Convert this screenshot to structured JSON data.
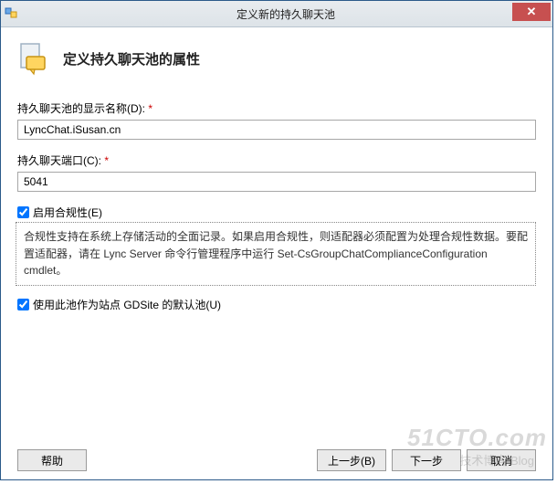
{
  "titlebar": {
    "title": "定义新的持久聊天池"
  },
  "header": {
    "heading": "定义持久聊天池的属性"
  },
  "fields": {
    "display_name_label": "持久聊天池的显示名称(D):",
    "display_name_value": "LyncChat.iSusan.cn",
    "port_label": "持久聊天端口(C):",
    "port_value": "5041"
  },
  "compliance": {
    "checkbox_label": "启用合规性(E)",
    "description": "合规性支持在系统上存储活动的全面记录。如果启用合规性，则适配器必须配置为处理合规性数据。要配置适配器，请在 Lync Server 命令行管理程序中运行 Set-CsGroupChatComplianceConfiguration cmdlet。"
  },
  "default_pool": {
    "checkbox_label": "使用此池作为站点 GDSite 的默认池(U)"
  },
  "buttons": {
    "help": "帮助",
    "back": "上一步(B)",
    "next": "下一步",
    "cancel": "取消"
  },
  "watermark": {
    "big": "51CTO.com",
    "small": "技术博客   Blog"
  }
}
